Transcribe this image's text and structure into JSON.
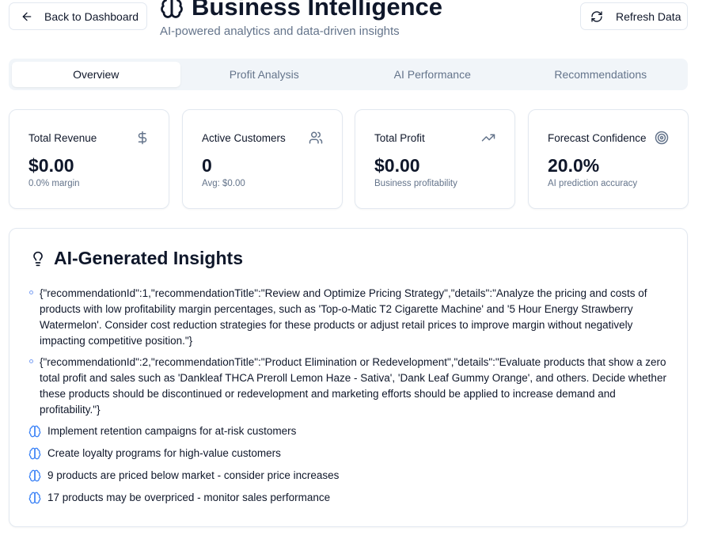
{
  "header": {
    "back_label": "Back to Dashboard",
    "title": "Business Intelligence",
    "subtitle": "AI-powered analytics and data-driven insights",
    "refresh_label": "Refresh Data"
  },
  "tabs": [
    {
      "label": "Overview",
      "active": true
    },
    {
      "label": "Profit Analysis",
      "active": false
    },
    {
      "label": "AI Performance",
      "active": false
    },
    {
      "label": "Recommendations",
      "active": false
    }
  ],
  "stats": [
    {
      "label": "Total Revenue",
      "value": "$0.00",
      "sub": "0.0% margin",
      "icon": "dollar-icon"
    },
    {
      "label": "Active Customers",
      "value": "0",
      "sub": "Avg: $0.00",
      "icon": "users-icon"
    },
    {
      "label": "Total Profit",
      "value": "$0.00",
      "sub": "Business profitability",
      "icon": "trending-up-icon"
    },
    {
      "label": "Forecast Confidence",
      "value": "20.0%",
      "sub": "AI prediction accuracy",
      "icon": "target-icon"
    }
  ],
  "insights": {
    "title": "AI-Generated Insights",
    "recommendations": [
      "{\"recommendationId\":1,\"recommendationTitle\":\"Review and Optimize Pricing Strategy\",\"details\":\"Analyze the pricing and costs of products with low profitability margin percentages, such as 'Top-o-Matic T2 Cigarette Machine' and '5 Hour Energy Strawberry Watermelon'. Consider cost reduction strategies for these products or adjust retail prices to improve margin without negatively impacting competitive position.\"}",
      "{\"recommendationId\":2,\"recommendationTitle\":\"Product Elimination or Redevelopment\",\"details\":\"Evaluate products that show a zero total profit and sales such as 'Dankleaf THCA Preroll Lemon Haze - Sativa', 'Dank Leaf Gummy Orange', and others. Decide whether these products should be discontinued or redevelopment and marketing efforts should be applied to increase demand and profitability.\"}"
    ],
    "tips": [
      "Implement retention campaigns for at-risk customers",
      "Create loyalty programs for high-value customers",
      "9 products are priced below market - consider price increases",
      "17 products may be overpriced - monitor sales performance"
    ]
  }
}
